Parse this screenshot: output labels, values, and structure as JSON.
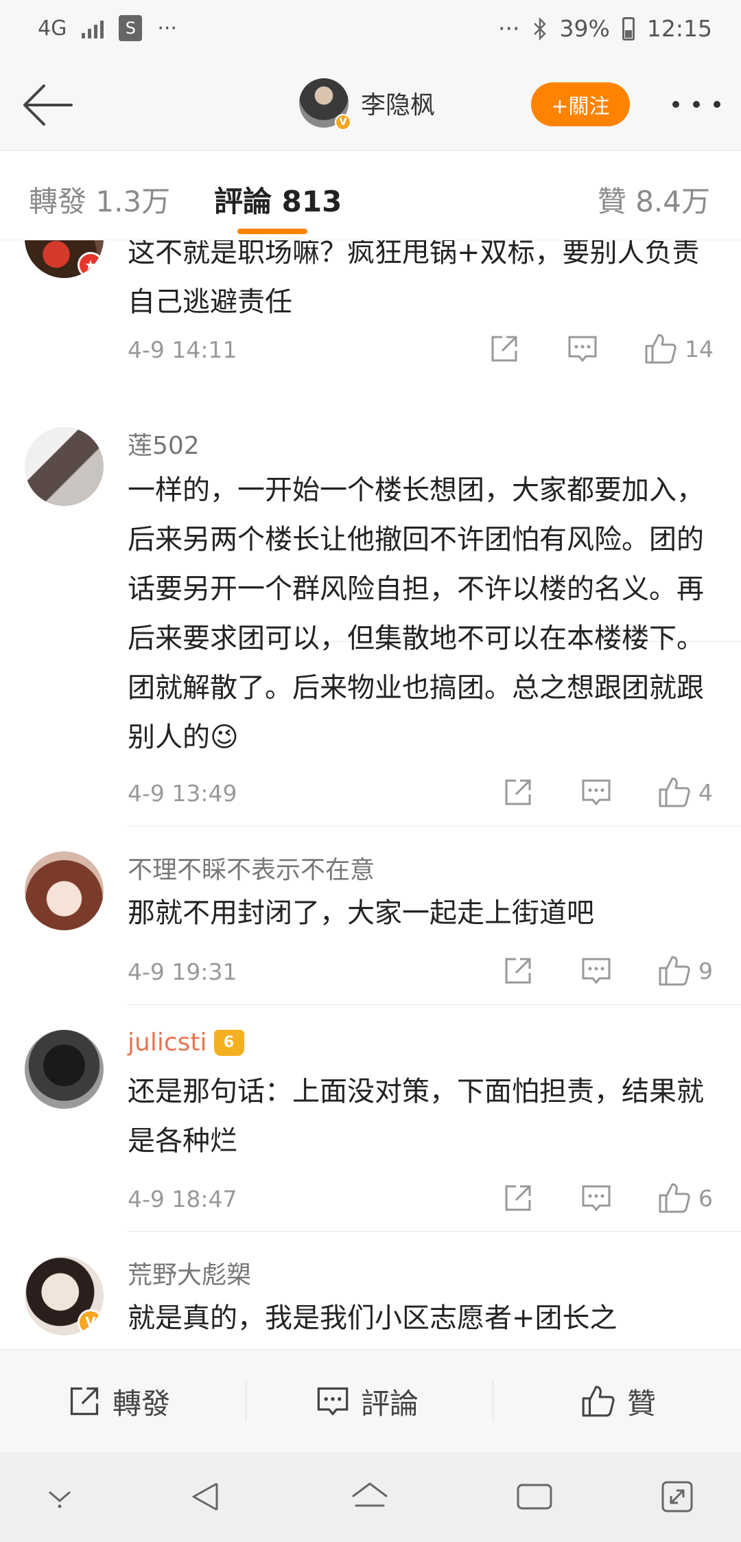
{
  "status_bar": {
    "network": "4G",
    "shop_glyph": "S",
    "dots_left": "···",
    "dots_right": "···",
    "battery": "39%",
    "time": "12:15"
  },
  "header": {
    "author_name": "李隐枫",
    "follow_label": "+關注",
    "verified_badge": "V"
  },
  "tabs": {
    "repost": "轉發 1.3万",
    "comments": "評論 813",
    "likes": "贊 8.4万",
    "active": "comments"
  },
  "comments": [
    {
      "name": "",
      "text": "这不就是职场嘛？疯狂甩锅+双标，要别人负责自己逃避责任",
      "time": "4-9 14:11",
      "likes": "14"
    },
    {
      "name": "莲502",
      "text": "一样的，一开始一个楼长想团，大家都要加入，后来另两个楼长让他撤回不许团怕有风险。团的话要另开一个群风险自担，不许以楼的名义。再后来要求团可以，但集散地不可以在本楼楼下。团就解散了。后来物业也搞团。总之想跟团就跟别人的",
      "emoji": "😉",
      "time": "4-9 13:49",
      "likes": "4"
    },
    {
      "name": "不理不睬不表示不在意",
      "text": "那就不用封闭了，大家一起走上街道吧",
      "time": "4-9 19:31",
      "likes": "9"
    },
    {
      "name": "julicsti",
      "vip_level": "6",
      "text": "还是那句话：上面没对策，下面怕担责，结果就是各种烂",
      "time": "4-9 18:47",
      "likes": "6"
    },
    {
      "name": "荒野大彪槊",
      "text": "就是真的，我是我们小区志愿者+团长之",
      "verified_badge": "V"
    }
  ],
  "bottom_bar": {
    "repost": "轉發",
    "comment": "評論",
    "like": "贊"
  },
  "colors": {
    "accent": "#ff8200",
    "verified": "#f5a623",
    "vip_name": "#eb7350",
    "muted": "#999999"
  },
  "icons": {
    "back": "arrow-left-icon",
    "more": "more-dots-icon",
    "share": "share-icon",
    "comment": "comment-icon",
    "like": "thumbs-up-icon"
  }
}
